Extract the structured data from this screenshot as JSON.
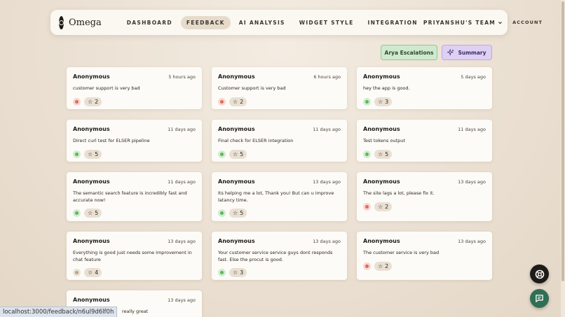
{
  "nav": {
    "brand": "Omega",
    "links": [
      "DASHBOARD",
      "FEEDBACK",
      "AI ANALYSIS",
      "WIDGET STYLE",
      "INTEGRATION"
    ],
    "active_index": 1,
    "team": "PRIYANSHU'S TEAM",
    "account": "ACCOUNT"
  },
  "actions": {
    "escalations": "Arya Escalations",
    "summary": "Summary"
  },
  "feedback": [
    {
      "author": "Anonymous",
      "time": "5 hours ago",
      "message": "customer support is very bad",
      "sentiment": "negative",
      "rating": "2"
    },
    {
      "author": "Anonymous",
      "time": "6 hours ago",
      "message": "Customer support is very bad",
      "sentiment": "negative",
      "rating": "2"
    },
    {
      "author": "Anonymous",
      "time": "5 days ago",
      "message": "hey the app is good.",
      "sentiment": "positive",
      "rating": "3"
    },
    {
      "author": "Anonymous",
      "time": "11 days ago",
      "message": "Direct curl test for ELSER pipeline",
      "sentiment": "positive",
      "rating": "5"
    },
    {
      "author": "Anonymous",
      "time": "11 days ago",
      "message": "Final check for ELSER integration",
      "sentiment": "positive",
      "rating": "5"
    },
    {
      "author": "Anonymous",
      "time": "11 days ago",
      "message": "Test tokens output",
      "sentiment": "positive",
      "rating": "5"
    },
    {
      "author": "Anonymous",
      "time": "11 days ago",
      "message": "The semantic search feature is incredibly fast and accurate now!",
      "sentiment": "positive",
      "rating": "5"
    },
    {
      "author": "Anonymous",
      "time": "13 days ago",
      "message": "Its helping me a lot, Thank you! But can u improve latancy time.",
      "sentiment": "positive",
      "rating": "5"
    },
    {
      "author": "Anonymous",
      "time": "13 days ago",
      "message": "The site lags a lot, please fix it.",
      "sentiment": "negative",
      "rating": "2"
    },
    {
      "author": "Anonymous",
      "time": "13 days ago",
      "message": "Everything is good just needs some improvement in chat feature",
      "sentiment": "neutral",
      "rating": "4"
    },
    {
      "author": "Anonymous",
      "time": "13 days ago",
      "message": "Your customer service service guys dont responds fast. Else the procut is good.",
      "sentiment": "positive",
      "rating": "3"
    },
    {
      "author": "Anonymous",
      "time": "13 days ago",
      "message": "The customer service is very bad",
      "sentiment": "negative",
      "rating": "2"
    },
    {
      "author": "Anonymous",
      "time": "13 days ago",
      "message": "really great",
      "sentiment": "neutral",
      "rating": ""
    }
  ],
  "status_url": "localhost:3000/feedback/n6ul9d6lf0h",
  "icons": {
    "logo": "omega-logo-icon",
    "summary": "sparkle-icon",
    "star": "star-icon",
    "support_fab": "lifebuoy-icon",
    "chat_fab": "chat-icon",
    "team_chevron": "chevron-down-icon"
  },
  "colors": {
    "positive": "#5cb85c",
    "negative": "#e06a5a",
    "neutral": "#b7a58e",
    "escalations_bg": "#cfe9cf",
    "summary_bg": "#ddd0f3",
    "chat_fab": "#2f6f55"
  }
}
